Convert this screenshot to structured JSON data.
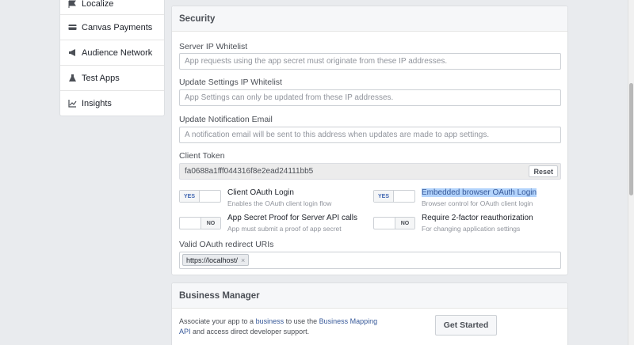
{
  "sidebar": {
    "items": [
      {
        "label": "Localize",
        "icon": "flag-icon"
      },
      {
        "label": "Canvas Payments",
        "icon": "card-icon"
      },
      {
        "label": "Audience Network",
        "icon": "megaphone-icon"
      },
      {
        "label": "Test Apps",
        "icon": "flask-icon"
      },
      {
        "label": "Insights",
        "icon": "chart-icon"
      }
    ]
  },
  "security": {
    "title": "Security",
    "server_ip": {
      "label": "Server IP Whitelist",
      "placeholder": "App requests using the app secret must originate from these IP addresses."
    },
    "update_ip": {
      "label": "Update Settings IP Whitelist",
      "placeholder": "App Settings can only be updated from these IP addresses."
    },
    "notify_email": {
      "label": "Update Notification Email",
      "placeholder": "A notification email will be sent to this address when updates are made to app settings."
    },
    "client_token": {
      "label": "Client Token",
      "value": "fa0688a1fff044316f8e2ead24111bb5",
      "reset_label": "Reset"
    },
    "toggles": {
      "client_oauth": {
        "state": "YES",
        "title": "Client OAuth Login",
        "desc": "Enables the OAuth client login flow"
      },
      "embedded_oauth": {
        "state": "YES",
        "title": "Embedded browser OAuth Login",
        "desc": "Browser control for OAuth client login"
      },
      "app_secret_proof": {
        "state": "NO",
        "title": "App Secret Proof for Server API calls",
        "desc": "App must submit a proof of app secret"
      },
      "two_factor": {
        "state": "NO",
        "title": "Require 2-factor reauthorization",
        "desc": "For changing application settings"
      }
    },
    "redirect_uris": {
      "label": "Valid OAuth redirect URIs",
      "tags": [
        "https://localhost/"
      ],
      "remove": "×"
    }
  },
  "business": {
    "title": "Business Manager",
    "text_a": "Associate your app to a ",
    "link_a": "business",
    "text_b": " to use the ",
    "link_b": "Business Mapping API",
    "text_c": " and access direct developer support.",
    "button": "Get Started"
  },
  "colors": {
    "link": "#365899",
    "toggle_on": "#4267b2",
    "highlight": "#b3d4fc"
  }
}
